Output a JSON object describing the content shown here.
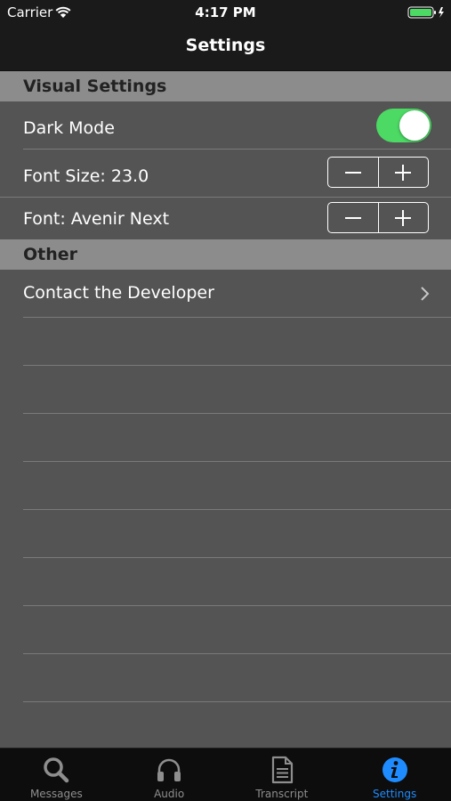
{
  "status_bar": {
    "carrier": "Carrier",
    "time": "4:17 PM"
  },
  "nav": {
    "title": "Settings"
  },
  "sections": {
    "visual": {
      "header": "Visual Settings",
      "dark_mode": {
        "label": "Dark Mode",
        "enabled": true
      },
      "font_size": {
        "label": "Font Size:  23.0"
      },
      "font": {
        "label": "Font:  Avenir Next"
      }
    },
    "other": {
      "header": "Other",
      "contact": {
        "label": "Contact the Developer"
      }
    }
  },
  "tabs": [
    {
      "label": "Messages",
      "icon": "search-icon"
    },
    {
      "label": "Audio",
      "icon": "headphones-icon"
    },
    {
      "label": "Transcript",
      "icon": "document-icon"
    },
    {
      "label": "Settings",
      "icon": "info-icon",
      "active": true
    }
  ],
  "colors": {
    "accent": "#1e8cff",
    "toggle_on": "#4cd964",
    "section_header": "#8c8c8c",
    "background": "#545454",
    "bars": "#1a1a1a"
  }
}
